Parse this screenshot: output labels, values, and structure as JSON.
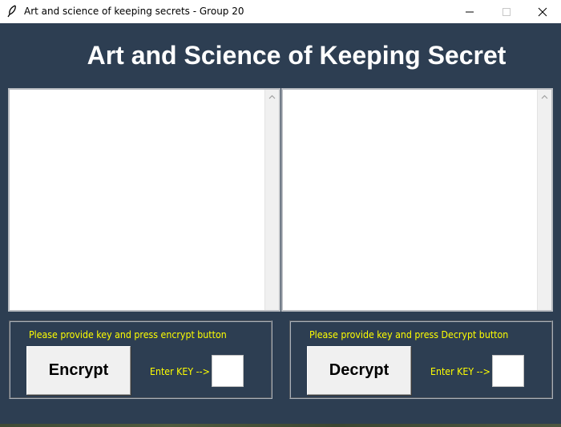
{
  "window": {
    "title": "Art and science of keeping secrets - Group 20",
    "icon": "feather-icon",
    "controls": [
      "minimize-icon",
      "maximize-icon",
      "close-icon"
    ]
  },
  "heading": "Art and Science of Keeping Secret",
  "panes": {
    "input_text": "",
    "output_text": ""
  },
  "encrypt": {
    "hint": "Please provide key and press encrypt button",
    "button_label": "Encrypt",
    "key_label": "Enter KEY -->",
    "key_value": ""
  },
  "decrypt": {
    "hint": "Please provide key and press Decrypt button",
    "button_label": "Decrypt",
    "key_label": "Enter KEY -->",
    "key_value": ""
  },
  "colors": {
    "background": "#2d3e52",
    "heading": "#ffffff",
    "hint_text": "#ffff00",
    "button_face": "#f0f0f0"
  }
}
